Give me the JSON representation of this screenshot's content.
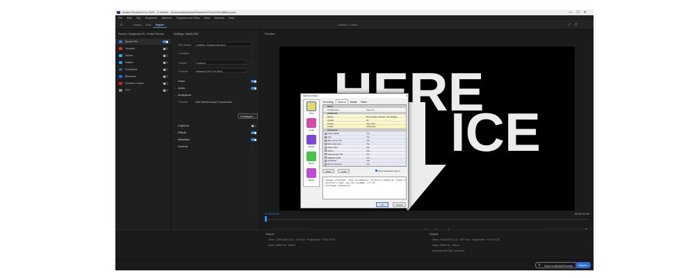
{
  "titlebar": {
    "title": "Adobe Premiere Pro 2024 - C:\\Users\\...\\Documents\\Adobe\\Premiere Pro\\24.0\\Untitled.prproj"
  },
  "menu": [
    "File",
    "Edit",
    "Clip",
    "Sequence",
    "Markers",
    "Graphics and Titles",
    "View",
    "Window",
    "Help"
  ],
  "top_tabs": [
    "Import",
    "Edit",
    "Export"
  ],
  "project_title": "Untitled - Edited",
  "left": {
    "source_label": "Source:",
    "source_value": "Sequence 01 - Entire Source",
    "destinations": [
      {
        "label": "Media File",
        "on": true,
        "color": "#3d6bd8"
      },
      {
        "label": "Youtube",
        "on": false,
        "color": "#e02b2b"
      },
      {
        "label": "Vimeo",
        "on": false,
        "color": "#1ab7ea"
      },
      {
        "label": "Twitter",
        "on": false,
        "color": "#1d9bf0"
      },
      {
        "label": "Facebook",
        "on": false,
        "color": "#3b5998"
      },
      {
        "label": "Behance",
        "on": false,
        "color": "#1769ff"
      },
      {
        "label": "Creative Cloud",
        "on": false,
        "color": "#da1f26"
      },
      {
        "label": "FTP",
        "on": false,
        "color": "#888888"
      }
    ]
  },
  "settings": {
    "header": "Settings",
    "header_sub": "Media File",
    "file_name_label": "File Name",
    "file_name_value": "Untitled_Sequence.mp4",
    "location_label": "Location",
    "location_value": "...",
    "preset_label": "Preset",
    "preset_value": "Custom",
    "format_label": "Format",
    "format_value": "Wraptor DCP (H.264)",
    "sections": [
      {
        "label": "Video",
        "toggle": true
      },
      {
        "label": "Audio",
        "toggle": true
      },
      {
        "label": "Multiplexer",
        "toggle": null
      }
    ],
    "format_field_label": "Format",
    "format_field_value": "Use MainConcept Transcoder",
    "configure_label": "Configure...",
    "lower_sections": [
      {
        "label": "Captions",
        "toggle": false
      },
      {
        "label": "Effects",
        "toggle": true
      },
      {
        "label": "Metadata",
        "toggle": true
      },
      {
        "label": "General",
        "toggle": null
      }
    ]
  },
  "preview": {
    "label": "Preview",
    "video_text_line1": "HERE",
    "video_text_line2": "ICE",
    "tc_left": "00:00:00:00",
    "tc_right": "00:00:12:20",
    "range_label": "Range",
    "range_value": "Entire Source",
    "transport": "⏮ ◀ ▶ ▶ ⏭",
    "fit_label": "Fitting",
    "fit_value": "Scale to fit"
  },
  "bottom": {
    "source_title": "Source",
    "source_video": "Video: 1920x1080 (1.0) · 29.97fps · Progressive · 00:00:12:20",
    "source_audio": "Audio: 48000 Hz · Stereo",
    "output_title": "Output",
    "output_video": "Video: 1920x1080 (1.0) · 29.97 fps · Progressive · 00:00:12:20",
    "output_audio": "Audio: 48000 Hz · Stereo",
    "output_size": "Estimated File Size: Unknown"
  },
  "status": {
    "send_label": "Send to Media Encoder",
    "export_label": "Export"
  },
  "dialog": {
    "title": "MainConcept",
    "tabs": [
      "Encoding",
      "Options",
      "Bitrate",
      "Filters"
    ],
    "categories": [
      {
        "label": "Video",
        "color": "#e8d86a"
      },
      {
        "label": "Audio",
        "color": "#d44aa5"
      },
      {
        "label": "Subtitle",
        "color": "#7a4ad4"
      },
      {
        "label": "Muxer",
        "color": "#4ac24a"
      },
      {
        "label": "Effects",
        "color": "#c04ad4"
      }
    ],
    "rows": [
      {
        "k": "Basic",
        "v": "",
        "type": "group"
      },
      {
        "k": "Profile/Level",
        "v": "High 4.2",
        "type": "plain"
      },
      {
        "k": "Advanced",
        "v": "",
        "type": "group"
      },
      {
        "k": "Bitrate",
        "v": "Best Quality (Slower), No Scaling",
        "type": "yellow"
      },
      {
        "k": "Quality",
        "v": "23",
        "type": "yellow"
      },
      {
        "k": "Preset",
        "v": "Very Fast",
        "type": "yellow"
      },
      {
        "k": "Profile",
        "v": "Advanced",
        "type": "yellow"
      },
      {
        "k": "Advanced",
        "v": "",
        "type": "group"
      },
      {
        "k": "Frame Width",
        "v": "Yes",
        "type": "lav"
      },
      {
        "k": "Intra",
        "v": "Yes",
        "type": "lav"
      },
      {
        "k": "Max. frame size",
        "v": "Yes",
        "type": "lav"
      },
      {
        "k": "Main video dec.",
        "v": "Yes",
        "type": "lav"
      },
      {
        "k": "Interp. filter",
        "v": "Yes",
        "type": "lav"
      },
      {
        "k": "Stereo",
        "v": "Yes",
        "type": "lav"
      },
      {
        "k": "Stereoscopic 3D",
        "v": "Yes",
        "type": "lav"
      },
      {
        "k": "Adaptive GOP",
        "v": "Yes",
        "type": "lav"
      },
      {
        "k": "Interlaced",
        "v": "Yes",
        "type": "lav"
      },
      {
        "k": "Scene detection",
        "v": "Yes",
        "type": "lav"
      }
    ],
    "btn_save": "Save",
    "btn_load": "Load",
    "show_adv_label": "Show advanced options",
    "command": "-preset ultrafast -tune zerolatency -profile:v baseline -level 3.1\n-profile:v high -pix_fmt yuv420p -crf 23\n-movflags +faststart",
    "ok": "OK",
    "cancel": "Cancel"
  }
}
